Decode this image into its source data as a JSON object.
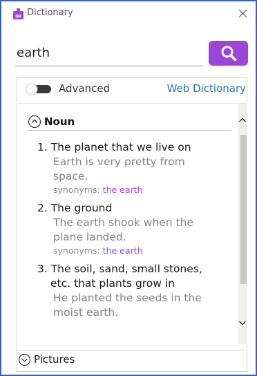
{
  "window": {
    "title": "Dictionary"
  },
  "search": {
    "value": "earth",
    "placeholder": ""
  },
  "options": {
    "advanced_label": "Advanced",
    "advanced_on": false,
    "web_dictionary_label": "Web Dictionary"
  },
  "sections": {
    "noun_label": "Noun",
    "pictures_label": "Pictures"
  },
  "definitions": [
    {
      "lines": [
        "1. The planet that we live on"
      ],
      "example_lines": [
        "Earth is very pretty from",
        "space."
      ],
      "synonyms_prefix": "synonyms: ",
      "synonym": "the earth"
    },
    {
      "lines": [
        "2. The ground"
      ],
      "example_lines": [
        "The earth shook when the",
        "plane landed."
      ],
      "synonyms_prefix": "synonyms: ",
      "synonym": "the earth"
    },
    {
      "lines": [
        "3. The soil, sand, small stones,",
        "etc. that plants grow in"
      ],
      "example_lines": [
        "He planted the seeds in the",
        "moist earth."
      ]
    }
  ],
  "colors": {
    "accent": "#9b46d9",
    "link": "#2a6dbd",
    "border": "#3a61b8"
  },
  "icons": {
    "app": "dictionary-icon",
    "close": "close-icon",
    "search": "search-icon",
    "collapse": "chevron-up-circle-icon",
    "expand": "chevron-down-circle-icon"
  }
}
